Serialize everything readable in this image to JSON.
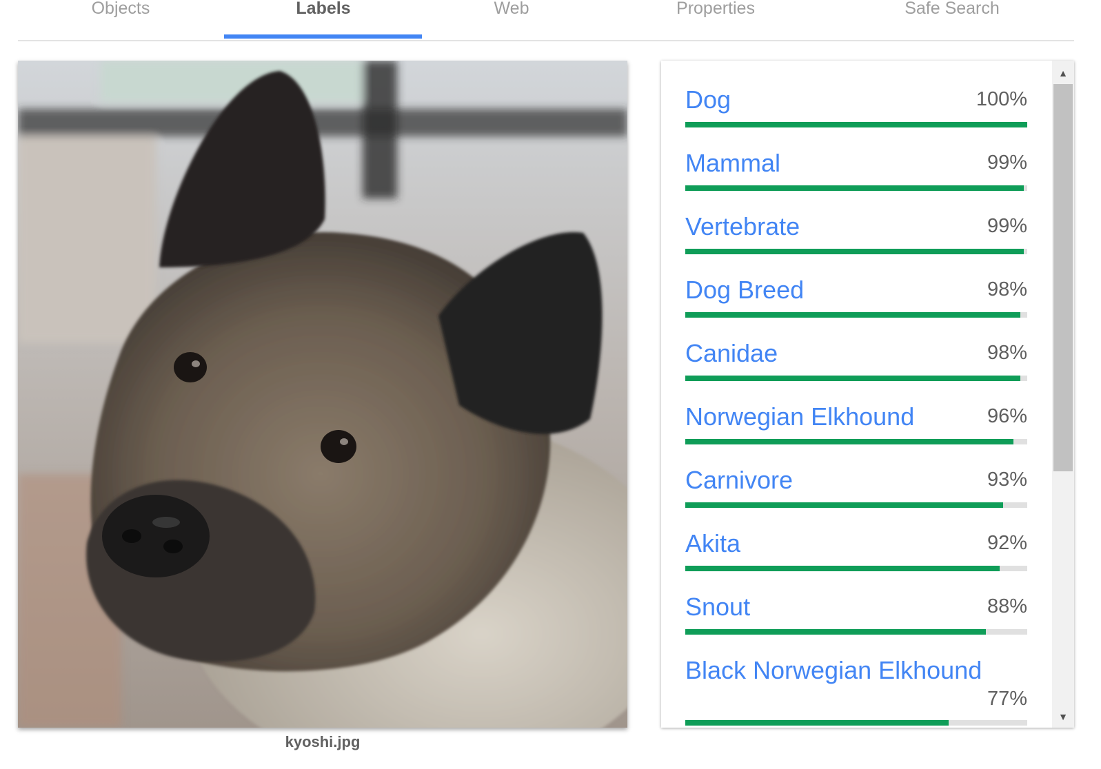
{
  "tabs": [
    {
      "label": "Objects"
    },
    {
      "label": "Labels",
      "active": true
    },
    {
      "label": "Web"
    },
    {
      "label": "Properties"
    },
    {
      "label": "Safe Search"
    }
  ],
  "image": {
    "filename": "kyoshi.jpg"
  },
  "labels": [
    {
      "name": "Dog",
      "score": "100%",
      "confidence": 1.0
    },
    {
      "name": "Mammal",
      "score": "99%",
      "confidence": 0.99
    },
    {
      "name": "Vertebrate",
      "score": "99%",
      "confidence": 0.99
    },
    {
      "name": "Dog Breed",
      "score": "98%",
      "confidence": 0.98
    },
    {
      "name": "Canidae",
      "score": "98%",
      "confidence": 0.98
    },
    {
      "name": "Norwegian Elkhound",
      "score": "96%",
      "confidence": 0.96
    },
    {
      "name": "Carnivore",
      "score": "93%",
      "confidence": 0.93
    },
    {
      "name": "Akita",
      "score": "92%",
      "confidence": 0.92
    },
    {
      "name": "Snout",
      "score": "88%",
      "confidence": 0.88
    },
    {
      "name": "Black Norwegian Elkhound",
      "score": "77%",
      "confidence": 0.77
    }
  ],
  "colors": {
    "accent": "#4285f4",
    "bar_fill": "#0f9d58",
    "bar_track": "#e0e0e0"
  },
  "icons": {
    "scroll_up": "triangle-up-icon",
    "scroll_down": "triangle-down-icon"
  }
}
